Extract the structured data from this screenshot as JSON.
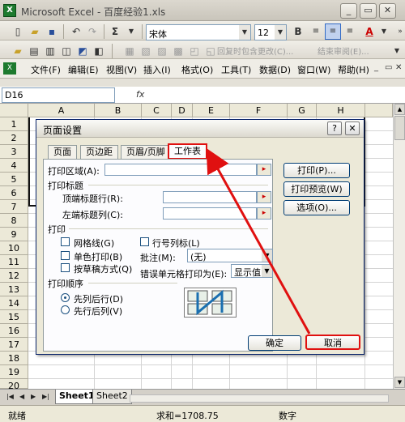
{
  "window": {
    "title": "Microsoft Excel - 百度经验1.xls",
    "app_icon": "excel-app-icon",
    "min": "_",
    "restore": "▭",
    "close": "✕"
  },
  "toolbar": {
    "font_name": "宋体",
    "font_size": "12",
    "bold": "B",
    "sum_symbol": "Σ",
    "font_color_label": "A",
    "review": "回复时包含更改(C)...",
    "end_review": "结束审阅(E)..."
  },
  "menubar": {
    "items": [
      "文件(F)",
      "编辑(E)",
      "视图(V)",
      "插入(I)",
      "格式(O)",
      "工具(T)",
      "数据(D)",
      "窗口(W)",
      "帮助(H)"
    ]
  },
  "formula": {
    "namebox": "D16",
    "fx": "fx"
  },
  "grid": {
    "columns": [
      "A",
      "B",
      "C",
      "D",
      "E",
      "F",
      "G",
      "H"
    ],
    "rows": [
      "1",
      "2",
      "3",
      "4",
      "5",
      "6",
      "7",
      "8",
      "9",
      "10",
      "11",
      "12",
      "13",
      "14",
      "15",
      "16",
      "17",
      "18",
      "19",
      "20"
    ]
  },
  "sheets": {
    "tabs": [
      "Sheet1",
      "Sheet2"
    ]
  },
  "status": {
    "left": "就绪",
    "sum": "求和=1708.75",
    "mode": "数字"
  },
  "dialog": {
    "title": "页面设置",
    "help": "?",
    "close": "✕",
    "tabs": [
      "页面",
      "页边距",
      "页眉/页脚",
      "工作表"
    ],
    "print_area": "打印区域(A):",
    "print_titles": "打印标题",
    "top_rows": "顶端标题行(R):",
    "left_cols": "左端标题列(C):",
    "print_section": "打印",
    "gridlines": "网格线(G)",
    "row_col_headers": "行号列标(L)",
    "monochrome": "单色打印(B)",
    "comments_label": "批注(M):",
    "comments_value": "(无)",
    "draft": "按草稿方式(Q)",
    "errors_label": "错误单元格打印为(E):",
    "errors_value": "显示值",
    "order_section": "打印顺序",
    "down_then_over": "先列后行(D)",
    "over_then_down": "先行后列(V)",
    "print_btn": "打印(P)...",
    "preview_btn": "打印预览(W)",
    "options_btn": "选项(O)...",
    "ok": "确定",
    "cancel": "取消"
  },
  "colors": {
    "highlight": "#e01010",
    "title_blue": "#0a246a"
  }
}
